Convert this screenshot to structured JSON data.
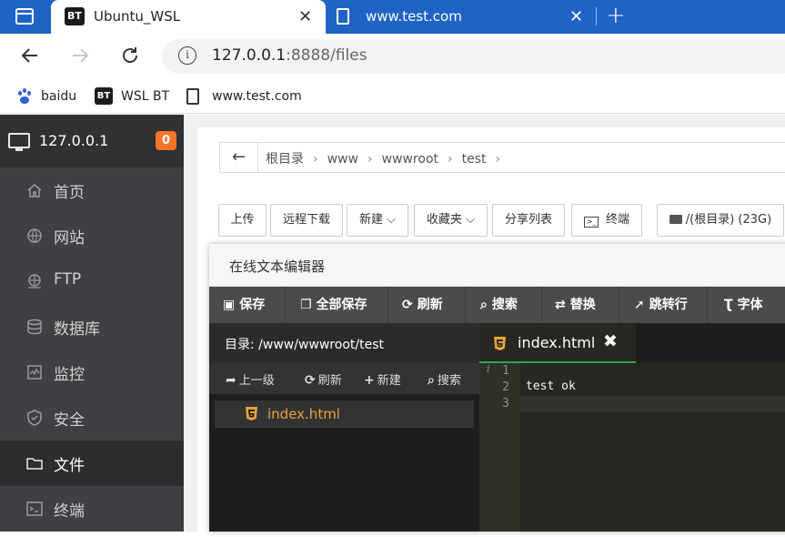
{
  "browser": {
    "tabs": [
      {
        "favicon_text": "BT",
        "title": "Ubuntu_WSL",
        "close": "✕",
        "active": true
      },
      {
        "title": "www.test.com",
        "close": "✕",
        "active": false
      }
    ],
    "new_tab": "+",
    "address": {
      "host": "127.0.0.1",
      "rest": ":8888/files"
    },
    "bookmarks": [
      {
        "icon": "baidu-paw-icon",
        "label": "baidu"
      },
      {
        "icon": "bt-icon",
        "icon_text": "BT",
        "label": "WSL BT"
      },
      {
        "icon": "page-icon",
        "label": "www.test.com"
      }
    ]
  },
  "sidebar": {
    "host": "127.0.0.1",
    "badge": "0",
    "items": [
      {
        "label": "首页",
        "icon": "home-icon"
      },
      {
        "label": "网站",
        "icon": "globe-icon"
      },
      {
        "label": "FTP",
        "icon": "ftp-icon"
      },
      {
        "label": "数据库",
        "icon": "database-icon"
      },
      {
        "label": "监控",
        "icon": "monitor-chart-icon"
      },
      {
        "label": "安全",
        "icon": "shield-icon"
      },
      {
        "label": "文件",
        "icon": "folder-icon",
        "active": true
      },
      {
        "label": "终端",
        "icon": "terminal-icon"
      }
    ]
  },
  "breadcrumb": {
    "back": "←",
    "items": [
      "根目录",
      "www",
      "wwwroot",
      "test"
    ],
    "sep": "›"
  },
  "toolbar": {
    "upload": "上传",
    "remote_download": "远程下载",
    "new": "新建",
    "favorites": "收藏夹",
    "share_list": "分享列表",
    "terminal": "终端",
    "disk": "/(根目录) (23G)"
  },
  "editor": {
    "title": "在线文本编辑器",
    "tools": [
      "保存",
      "全部保存",
      "刷新",
      "搜索",
      "替换",
      "跳转行",
      "字体"
    ],
    "dir_label": "目录: /www/wwwroot/test",
    "left_tools": [
      "上一级",
      "刷新",
      "新建",
      "搜索"
    ],
    "files": [
      "index.html"
    ],
    "open_tab": "index.html",
    "close": "✖",
    "line_numbers": [
      "1",
      "2",
      "3"
    ],
    "gutter_marker": "i",
    "code_lines": [
      "",
      "test ok",
      ""
    ]
  }
}
